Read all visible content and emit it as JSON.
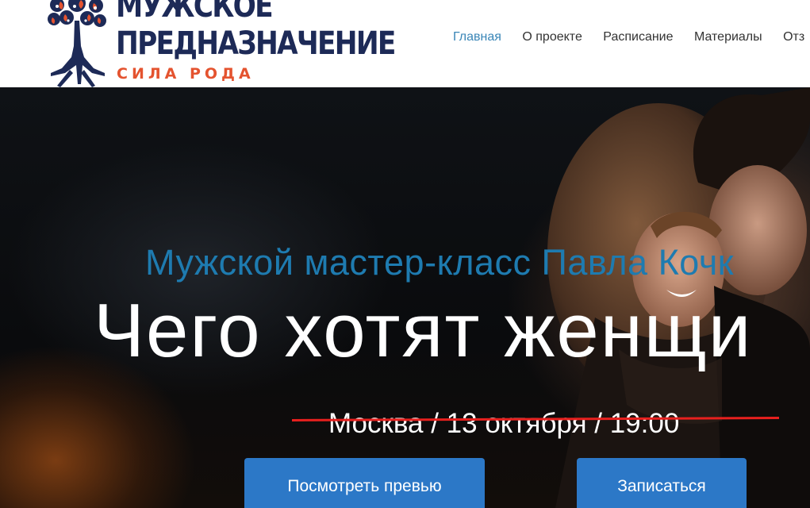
{
  "header": {
    "logo": {
      "line1": "МУЖСКОЕ",
      "line2": "ПРЕДНАЗНАЧЕНИЕ",
      "line3": "СИЛА РОДА",
      "colors": {
        "primary": "#1d2a57",
        "accent": "#e4532f"
      },
      "icon": "tree-roots-icon"
    },
    "nav": [
      {
        "label": "Главная",
        "active": true
      },
      {
        "label": "О проекте",
        "active": false
      },
      {
        "label": "Расписание",
        "active": false
      },
      {
        "label": "Материалы",
        "active": false
      },
      {
        "label": "Отз",
        "active": false
      }
    ]
  },
  "hero": {
    "subtitle": "Мужской мастер-класс Павла Кочк",
    "headline": "Чего хотят женщи",
    "event_info": "Москва / 13 октября / 19:00",
    "event_info_struck": true,
    "buttons": {
      "preview": "Посмотреть превью",
      "signup": "Записаться"
    },
    "colors": {
      "subtitle": "#1e7bb0",
      "button": "#2c78c7",
      "strike": "#e8201e",
      "nav_active": "#3a86b7"
    }
  }
}
